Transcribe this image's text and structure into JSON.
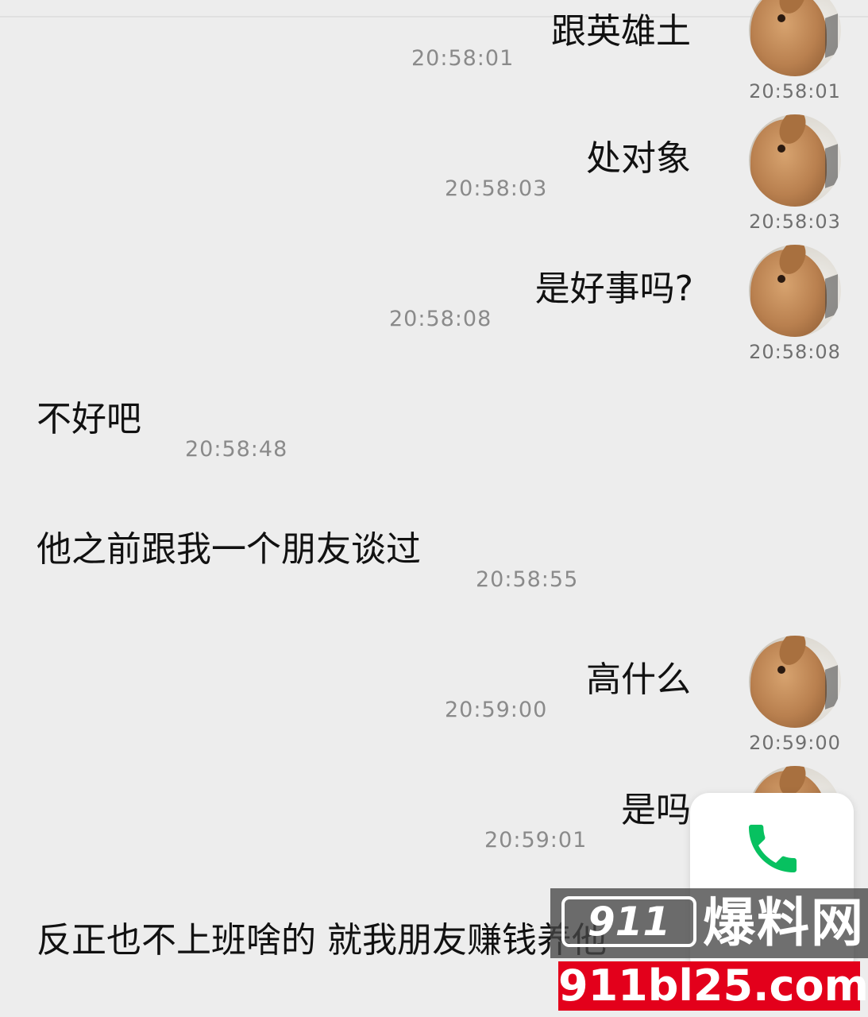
{
  "messages": [
    {
      "text": "跟英雄土",
      "time": "20:58:01",
      "avatar_time": "20:58:01"
    },
    {
      "text": "处对象",
      "time": "20:58:03",
      "avatar_time": "20:58:03"
    },
    {
      "text": "是好事吗?",
      "time": "20:58:08",
      "avatar_time": "20:58:08"
    },
    {
      "text": "不好吧",
      "time": "20:58:48"
    },
    {
      "text": "他之前跟我一个朋友谈过",
      "time": "20:58:55"
    },
    {
      "text": "高什么",
      "time": "20:59:00",
      "avatar_time": "20:59:00"
    },
    {
      "text": "是吗",
      "time": "20:59:01"
    },
    {
      "text": "反正也不上班啥的 就我朋友赚钱养他"
    }
  ],
  "avatar_icon": "rabbit-avatar-icon",
  "call_button": {
    "icon": "phone-icon",
    "color": "#07c160"
  },
  "watermark": {
    "badge": "911",
    "name": "爆料网",
    "url": "911bl25.com",
    "accent": "#e3001b"
  }
}
